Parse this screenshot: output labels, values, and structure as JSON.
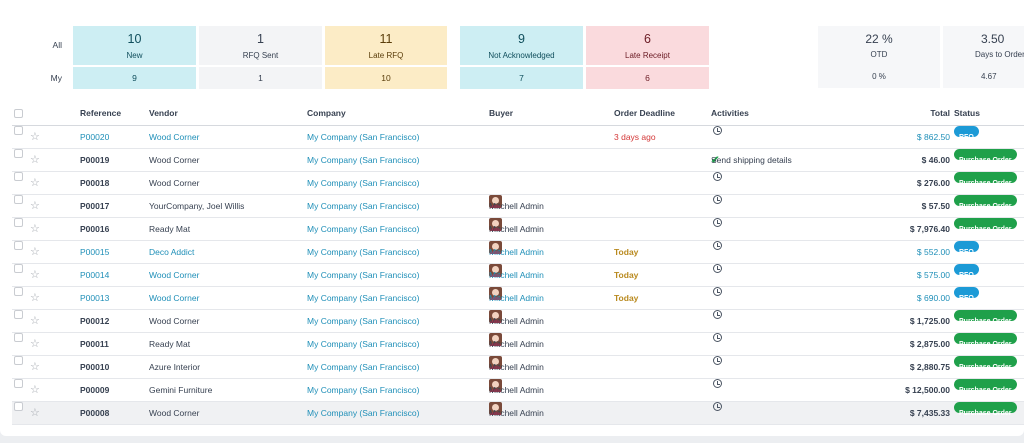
{
  "dashboard": {
    "row_labels": {
      "all": "All",
      "my": "My"
    },
    "tiles": [
      {
        "all": "10",
        "label": "New",
        "my": "9"
      },
      {
        "all": "1",
        "label": "RFQ Sent",
        "my": "1"
      },
      {
        "all": "11",
        "label": "Late RFQ",
        "my": "10"
      },
      {
        "all": "9",
        "label": "Not Acknowledged",
        "my": "7"
      },
      {
        "all": "6",
        "label": "Late Receipt",
        "my": "6"
      }
    ],
    "kpis": [
      {
        "value": "22 %",
        "label": "OTD",
        "my": "0 %"
      },
      {
        "value": "3.50",
        "label": "Days to Order",
        "my": "4.67"
      }
    ]
  },
  "table": {
    "headers": {
      "reference": "Reference",
      "vendor": "Vendor",
      "company": "Company",
      "buyer": "Buyer",
      "deadline": "Order Deadline",
      "activities": "Activities",
      "total": "Total",
      "status": "Status"
    },
    "rows": [
      {
        "ref": "P00020",
        "vendor": "Wood Corner",
        "company": "My Company (San Francisco)",
        "buyer": "",
        "deadline": "3 days ago",
        "deadline_style": "late",
        "activity": "",
        "total": "$ 862.50",
        "status": "RFQ"
      },
      {
        "ref": "P00019",
        "vendor": "Wood Corner",
        "company": "My Company (San Francisco)",
        "buyer": "",
        "deadline": "",
        "deadline_style": "",
        "activity": "Send shipping details",
        "total": "$ 46.00",
        "status": "Purchase Order"
      },
      {
        "ref": "P00018",
        "vendor": "Wood Corner",
        "company": "My Company (San Francisco)",
        "buyer": "",
        "deadline": "",
        "deadline_style": "",
        "activity": "",
        "total": "$ 276.00",
        "status": "Purchase Order"
      },
      {
        "ref": "P00017",
        "vendor": "YourCompany, Joel Willis",
        "company": "My Company (San Francisco)",
        "buyer": "Mitchell Admin",
        "deadline": "",
        "deadline_style": "",
        "activity": "",
        "total": "$ 57.50",
        "status": "Purchase Order"
      },
      {
        "ref": "P00016",
        "vendor": "Ready Mat",
        "company": "My Company (San Francisco)",
        "buyer": "Mitchell Admin",
        "deadline": "",
        "deadline_style": "",
        "activity": "",
        "total": "$ 7,976.40",
        "status": "Purchase Order"
      },
      {
        "ref": "P00015",
        "vendor": "Deco Addict",
        "company": "My Company (San Francisco)",
        "buyer": "Mitchell Admin",
        "deadline": "Today",
        "deadline_style": "today",
        "activity": "",
        "total": "$ 552.00",
        "status": "RFQ"
      },
      {
        "ref": "P00014",
        "vendor": "Wood Corner",
        "company": "My Company (San Francisco)",
        "buyer": "Mitchell Admin",
        "deadline": "Today",
        "deadline_style": "today",
        "activity": "",
        "total": "$ 575.00",
        "status": "RFQ"
      },
      {
        "ref": "P00013",
        "vendor": "Wood Corner",
        "company": "My Company (San Francisco)",
        "buyer": "Mitchell Admin",
        "deadline": "Today",
        "deadline_style": "today",
        "activity": "",
        "total": "$ 690.00",
        "status": "RFQ"
      },
      {
        "ref": "P00012",
        "vendor": "Wood Corner",
        "company": "My Company (San Francisco)",
        "buyer": "Mitchell Admin",
        "deadline": "",
        "deadline_style": "",
        "activity": "",
        "total": "$ 1,725.00",
        "status": "Purchase Order"
      },
      {
        "ref": "P00011",
        "vendor": "Ready Mat",
        "company": "My Company (San Francisco)",
        "buyer": "Mitchell Admin",
        "deadline": "",
        "deadline_style": "",
        "activity": "",
        "total": "$ 2,875.00",
        "status": "Purchase Order"
      },
      {
        "ref": "P00010",
        "vendor": "Azure Interior",
        "company": "My Company (San Francisco)",
        "buyer": "Mitchell Admin",
        "deadline": "",
        "deadline_style": "",
        "activity": "",
        "total": "$ 2,880.75",
        "status": "Purchase Order"
      },
      {
        "ref": "P00009",
        "vendor": "Gemini Furniture",
        "company": "My Company (San Francisco)",
        "buyer": "Mitchell Admin",
        "deadline": "",
        "deadline_style": "",
        "activity": "",
        "total": "$ 12,500.00",
        "status": "Purchase Order"
      },
      {
        "ref": "P00008",
        "vendor": "Wood Corner",
        "company": "My Company (San Francisco)",
        "buyer": "Mitchell Admin",
        "deadline": "",
        "deadline_style": "",
        "activity": "",
        "total": "$ 7,435.33",
        "status": "Purchase Order"
      }
    ]
  },
  "colors": {
    "rfq_badge": "#1c9ad6",
    "po_badge": "#1fa04a",
    "link": "#1f8fb8",
    "late": "#d43838",
    "today": "#b98a1f"
  }
}
